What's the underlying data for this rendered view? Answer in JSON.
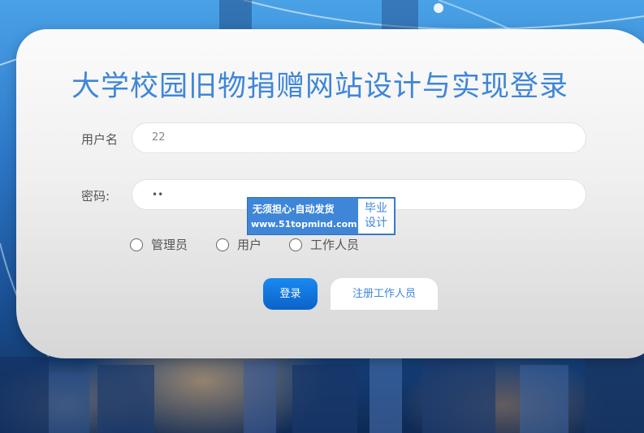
{
  "page": {
    "title": "大学校园旧物捐赠网站设计与实现登录"
  },
  "form": {
    "username_label": "用户名",
    "username_value": "22",
    "password_label": "密码:",
    "password_value": "••"
  },
  "roles": {
    "options": [
      "管理员",
      "用户",
      "工作人员"
    ]
  },
  "actions": {
    "login_label": "登录",
    "register_label": "注册工作人员"
  },
  "watermark": {
    "line1": "无须担心·自动发货",
    "line2": "www.51topmind.com",
    "tag_line1": "毕业",
    "tag_line2": "设计"
  },
  "colors": {
    "accent": "#3f86d8",
    "button_blue": "#1a8af0"
  }
}
